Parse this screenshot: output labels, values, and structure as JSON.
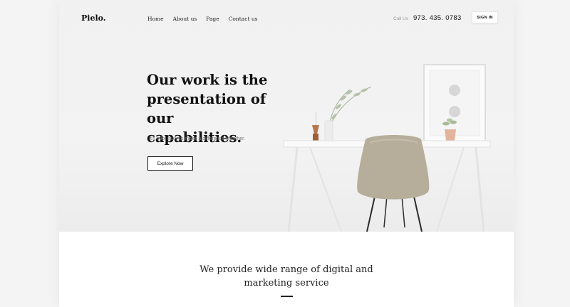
{
  "brand": {
    "logo": "Pielo."
  },
  "nav": {
    "items": [
      {
        "label": "Home"
      },
      {
        "label": "About us"
      },
      {
        "label": "Page"
      },
      {
        "label": "Contact us"
      }
    ]
  },
  "contact": {
    "call_label": "Call Us",
    "phone": "973. 435. 0783"
  },
  "header": {
    "signin_label": "SIGN IN"
  },
  "hero": {
    "headline_lines": [
      "Our work is the",
      "presentation of our",
      "capabilities."
    ],
    "subtext": "It's a lot easy to make a difference togather.",
    "cta_label": "Explore Now"
  },
  "services": {
    "title_lines": [
      "We provide wide range of digital and",
      "marketing service"
    ]
  },
  "colors": {
    "text": "#111111",
    "muted": "#7a7a7a",
    "hero_bg": "#f1f1f1",
    "chair": "#b6ad9a"
  }
}
